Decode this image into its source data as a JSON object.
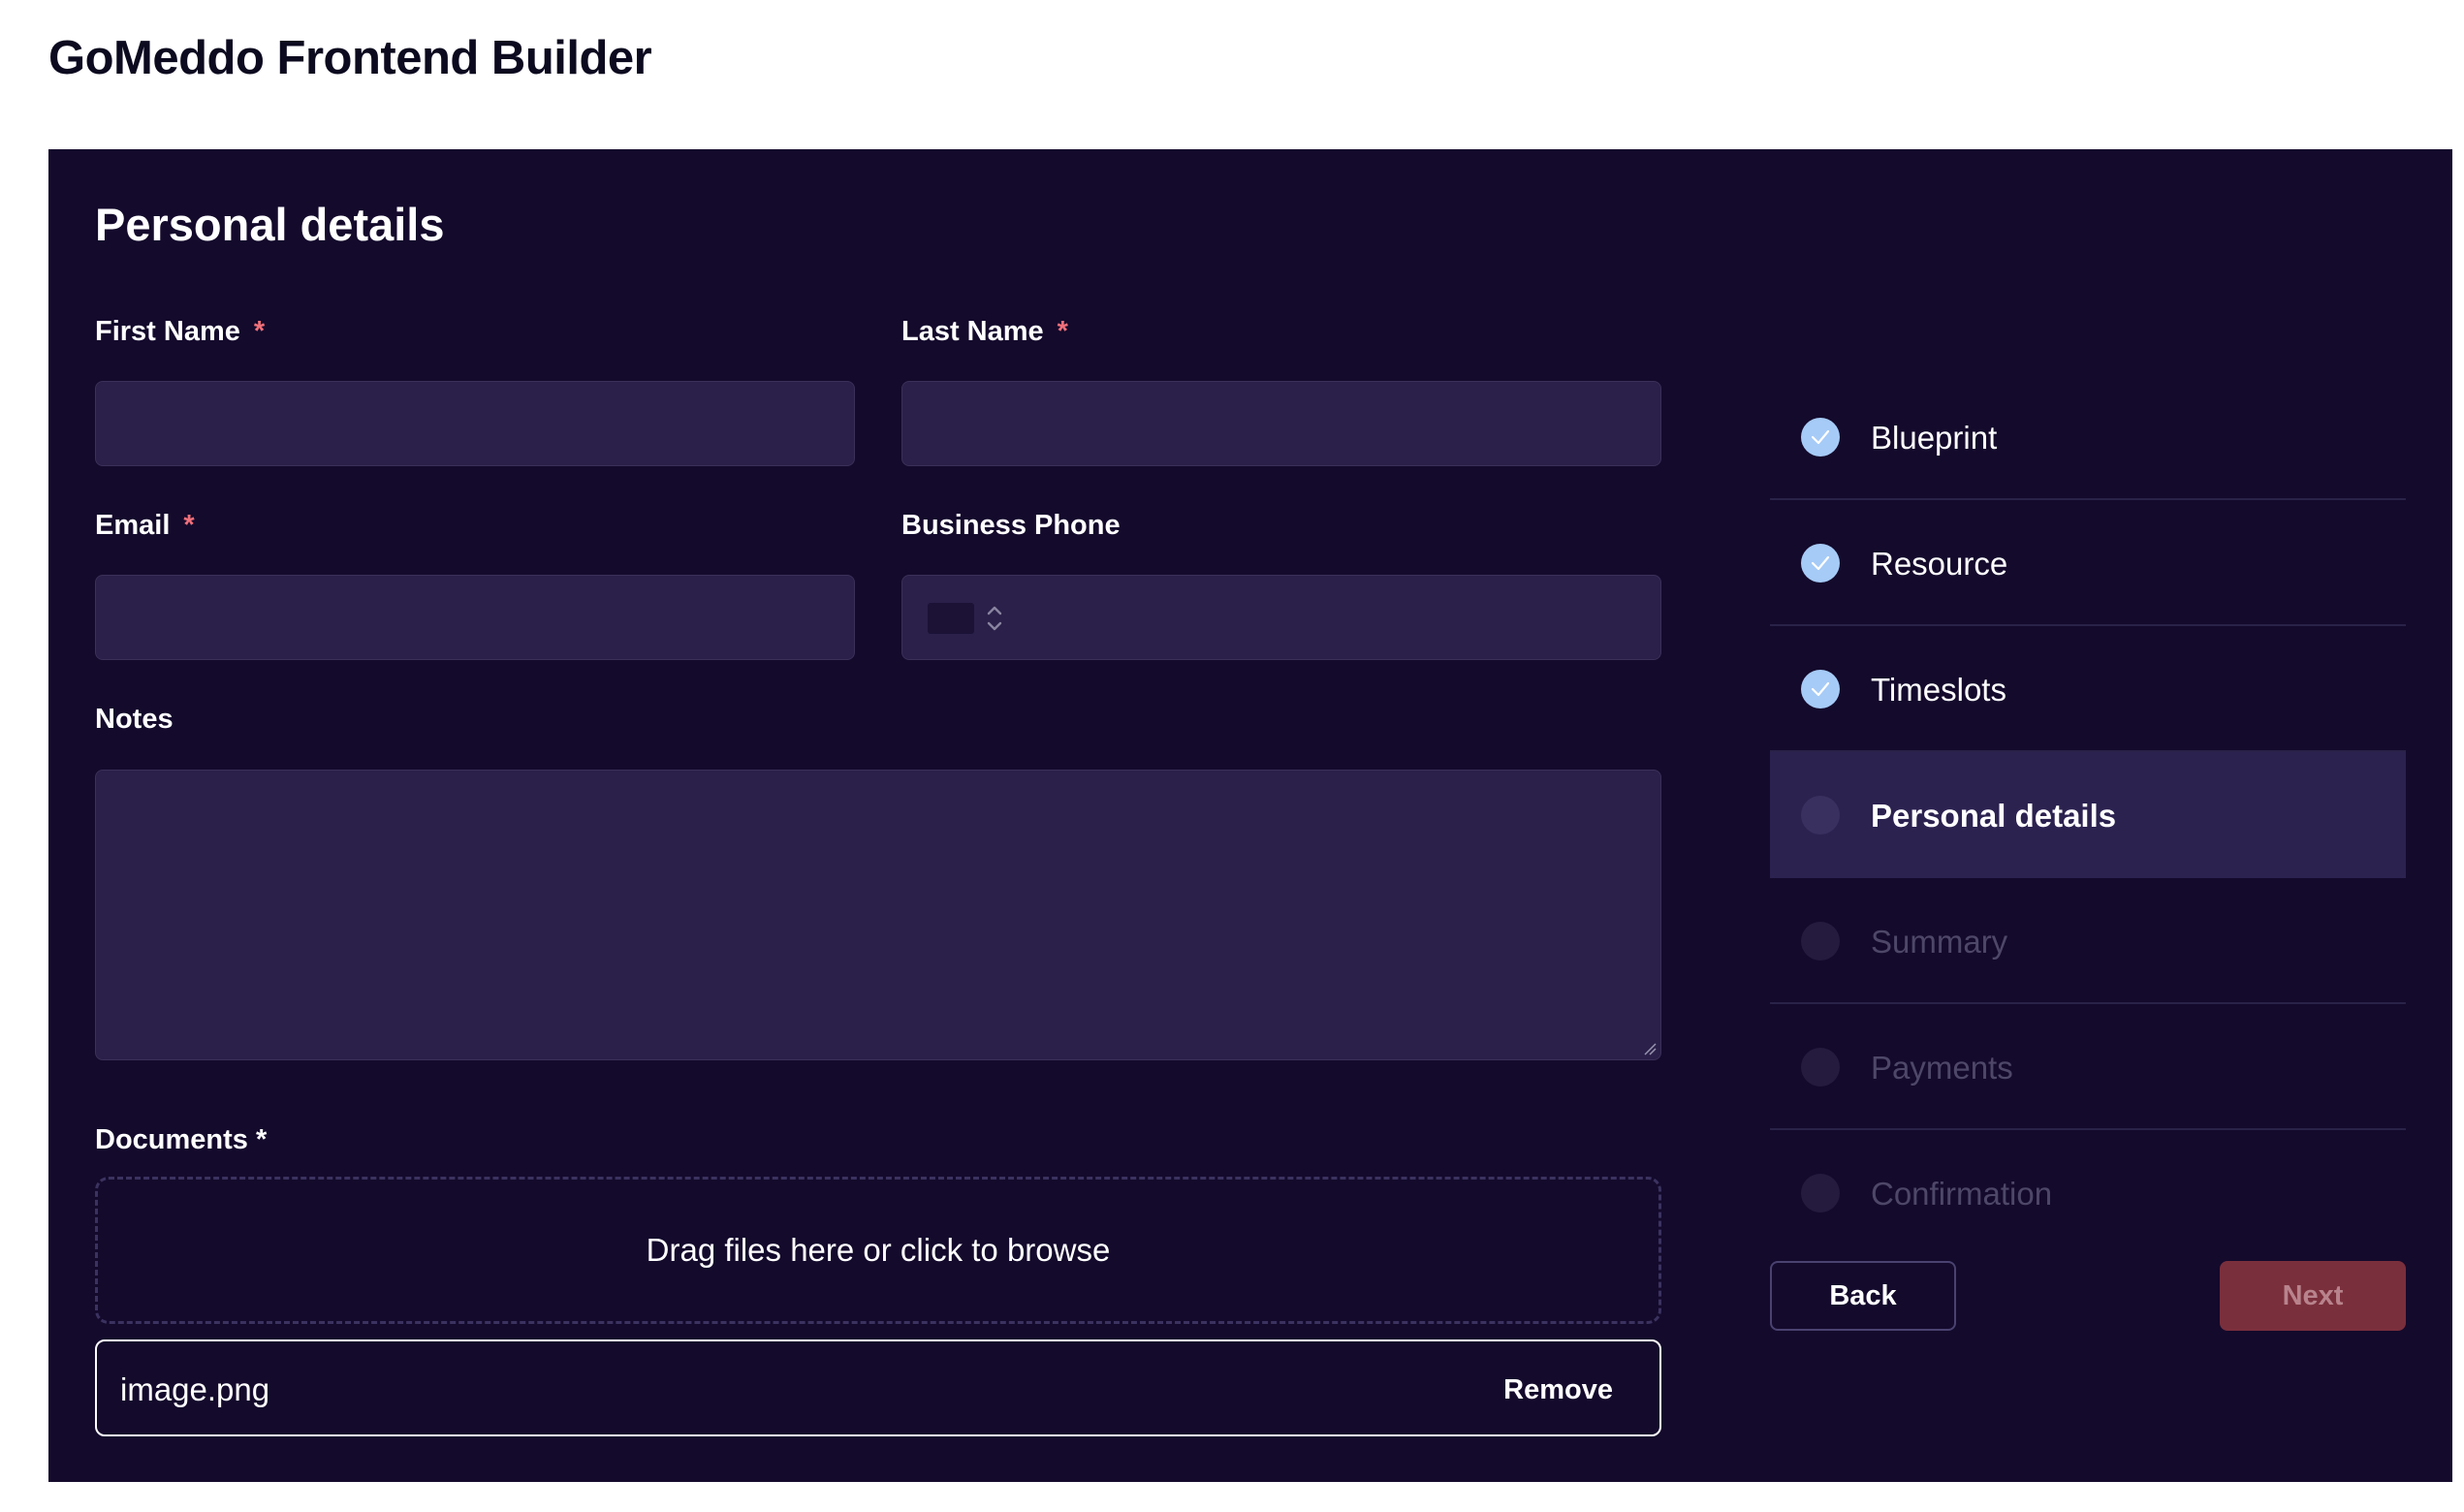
{
  "app": {
    "title": "GoMeddo Frontend Builder"
  },
  "form": {
    "title": "Personal details",
    "fields": {
      "first_name": {
        "label": "First Name",
        "required_mark": "*",
        "value": ""
      },
      "last_name": {
        "label": "Last Name",
        "required_mark": "*",
        "value": ""
      },
      "email": {
        "label": "Email",
        "required_mark": "*",
        "value": ""
      },
      "business_phone": {
        "label": "Business Phone",
        "value": ""
      },
      "notes": {
        "label": "Notes",
        "value": ""
      }
    },
    "documents": {
      "label": "Documents *",
      "dropzone_text": "Drag files here or click to browse",
      "files": [
        {
          "name": "image.png",
          "remove_label": "Remove"
        }
      ]
    }
  },
  "stepper": {
    "steps": [
      {
        "label": "Blueprint",
        "state": "done"
      },
      {
        "label": "Resource",
        "state": "done"
      },
      {
        "label": "Timeslots",
        "state": "done"
      },
      {
        "label": "Personal details",
        "state": "current"
      },
      {
        "label": "Summary",
        "state": "pending"
      },
      {
        "label": "Payments",
        "state": "pending"
      },
      {
        "label": "Confirmation",
        "state": "pending"
      }
    ]
  },
  "nav": {
    "back_label": "Back",
    "next_label": "Next"
  },
  "colors": {
    "panel_bg": "#140a2c",
    "input_bg": "#2a2049",
    "check_done": "#a6cbf7",
    "required": "#f0707a",
    "next_button": "#7a2f3c"
  }
}
